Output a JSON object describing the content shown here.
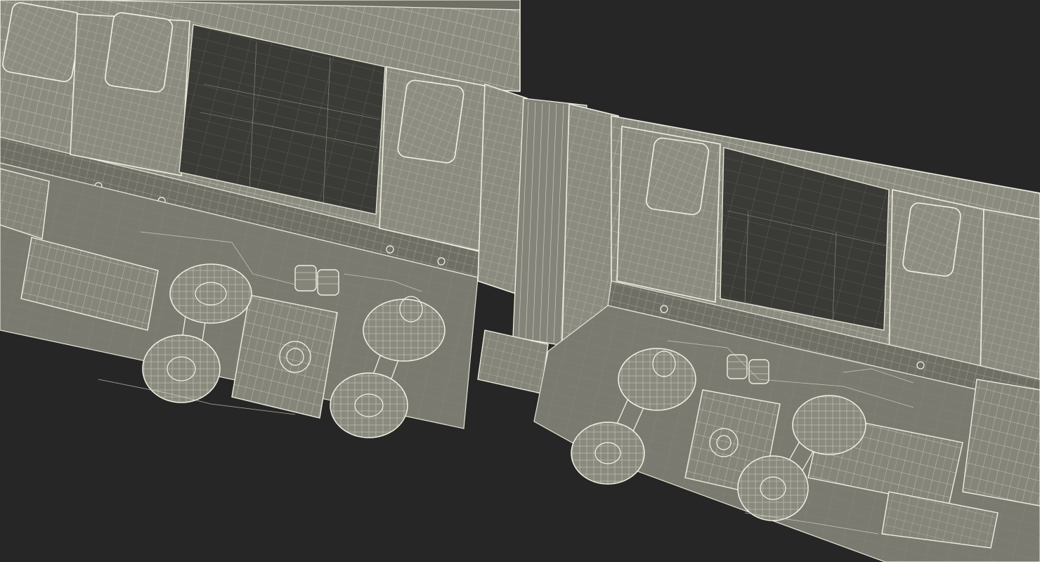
{
  "scene": {
    "background_color": "#262626",
    "mesh_fill_color": "#8b8b80",
    "wireframe_color": "#efeee0",
    "interior_color": "#3a3b36",
    "subject": "wireframe-render-two-coupled-rail-cars-underside"
  }
}
